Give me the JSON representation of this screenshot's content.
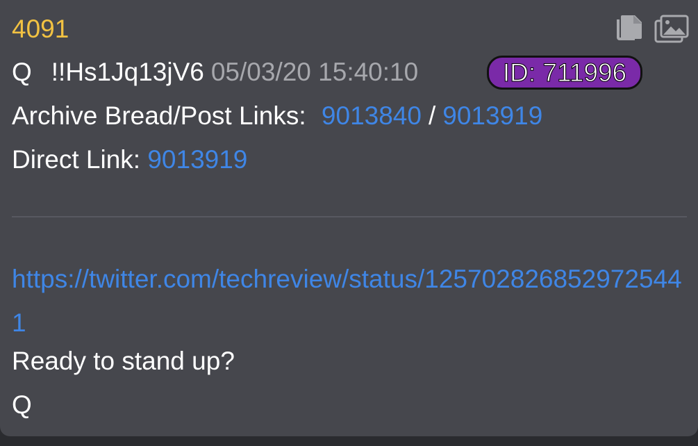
{
  "post": {
    "number": "4091",
    "author": "Q",
    "tripcode": "!!Hs1Jq13jV6",
    "timestamp": "05/03/20 15:40:10",
    "id_badge": "ID: 711996",
    "id_badge_color": "#7a2aa8",
    "archive_label": "Archive Bread/Post Links:",
    "archive_link_1": "9013840",
    "archive_separator": "/",
    "archive_link_2": "9013919",
    "direct_label": "Direct Link:",
    "direct_link": "9013919",
    "tweet_url": "https://twitter.com/techreview/status/1257028268529725441",
    "body_line": "Ready to stand up?",
    "signature": "Q"
  },
  "icons": {
    "copy": "copy-icon",
    "image": "image-gallery-icon"
  },
  "colors": {
    "post_number": "#f2c242",
    "link": "#3f86e6",
    "timestamp": "#a7a8ad",
    "card_background": "#46474d"
  }
}
